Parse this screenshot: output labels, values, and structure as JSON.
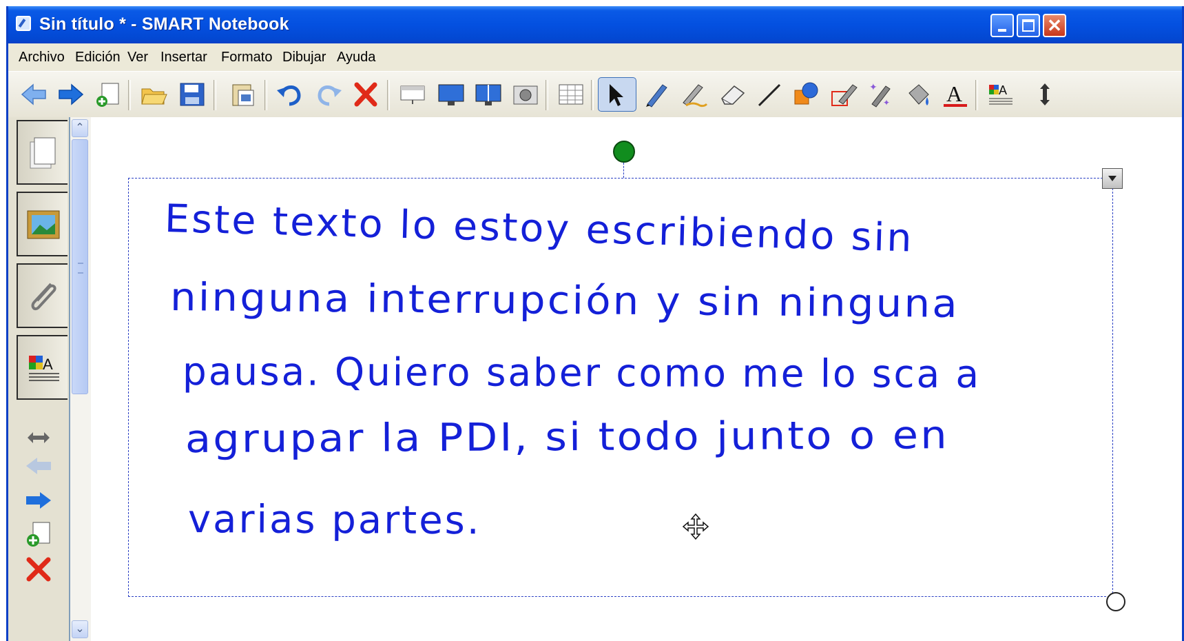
{
  "window": {
    "title": "Sin título * - SMART Notebook"
  },
  "menu": {
    "items": [
      "Archivo",
      "Edición",
      "Ver",
      "Insertar",
      "Formato",
      "Dibujar",
      "Ayuda"
    ]
  },
  "toolbar": {
    "icons": [
      "back-arrow-icon",
      "forward-arrow-icon",
      "add-page-icon",
      "open-folder-icon",
      "save-icon",
      "paste-icon",
      "undo-icon",
      "redo-icon",
      "delete-icon",
      "screen-shade-icon",
      "full-screen-icon",
      "dual-display-icon",
      "capture-icon",
      "table-icon",
      "select-icon",
      "pen-icon",
      "creative-pen-icon",
      "eraser-icon",
      "line-icon",
      "shape-icon",
      "shape-pen-icon",
      "magic-pen-icon",
      "fill-icon",
      "text-icon",
      "properties-icon",
      "move-toolbar-icon"
    ]
  },
  "sidebar": {
    "tabs": [
      "page-sorter-icon",
      "gallery-icon",
      "attachments-icon",
      "properties-icon"
    ]
  },
  "canvas": {
    "handwriting": [
      "Este texto lo estoy escribiendo sin",
      "ninguna interrupción y sin ninguna",
      "pausa. Quiero saber como me lo sca a",
      "agrupar la PDI, si todo junto o en",
      "varias partes."
    ]
  },
  "colors": {
    "ink": "#1420d8",
    "titlebar": "#0450e0",
    "rotate_handle": "#118d1e"
  }
}
